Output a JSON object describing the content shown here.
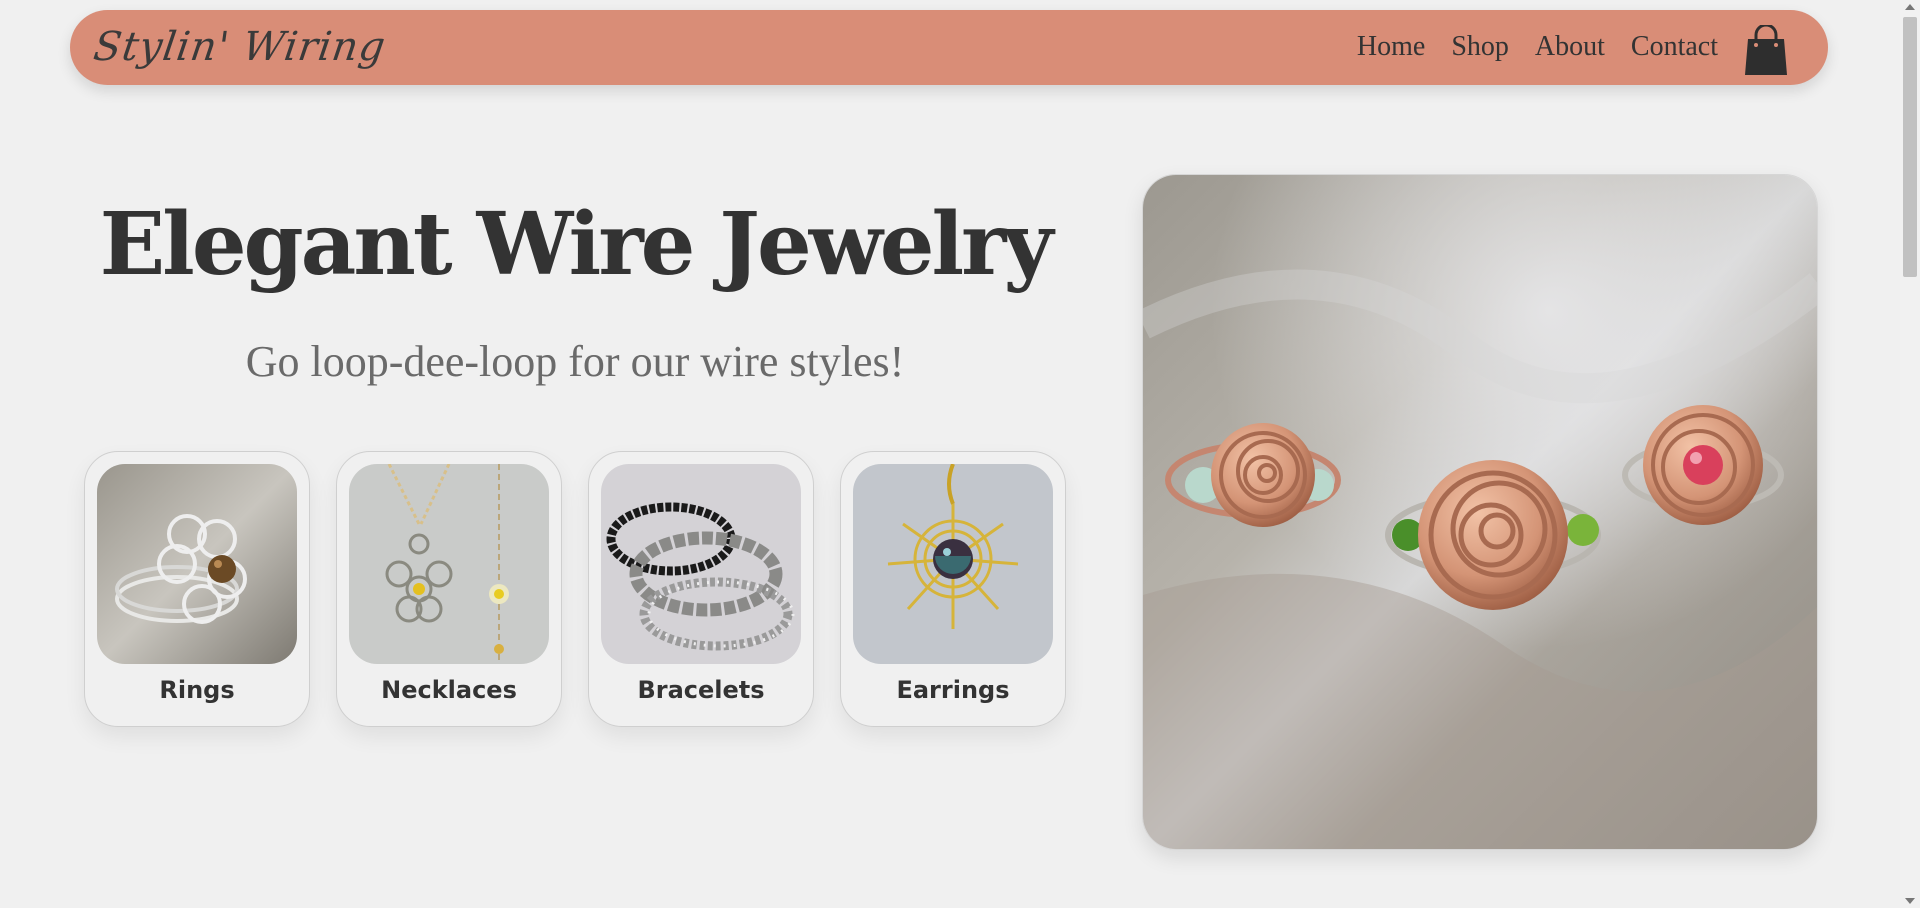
{
  "header": {
    "logo": "Stylin' Wiring",
    "nav": [
      "Home",
      "Shop",
      "About",
      "Contact"
    ],
    "cart_icon": "shopping-bag-icon",
    "background": "#d98d77"
  },
  "hero": {
    "title": "Elegant Wire Jewelry",
    "subtitle": "Go loop-dee-loop for our wire styles!"
  },
  "categories": [
    {
      "label": "Rings"
    },
    {
      "label": "Necklaces"
    },
    {
      "label": "Bracelets"
    },
    {
      "label": "Earrings"
    }
  ],
  "colors": {
    "page_background": "#f0f0f0",
    "text": "#333333",
    "subtitle": "#6a6a6a"
  }
}
